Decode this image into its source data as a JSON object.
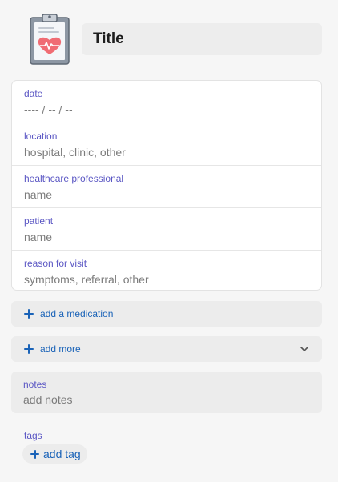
{
  "header": {
    "icon": "clipboard-heart-icon",
    "title": "Title"
  },
  "fields": [
    {
      "label": "date",
      "placeholder": "---- / -- / --"
    },
    {
      "label": "location",
      "placeholder": "hospital, clinic, other"
    },
    {
      "label": "healthcare professional",
      "placeholder": "name"
    },
    {
      "label": "patient",
      "placeholder": "name"
    },
    {
      "label": "reason for visit",
      "placeholder": "symptoms, referral, other"
    }
  ],
  "actions": {
    "add_medication": {
      "label": "add a medication",
      "icon": "plus-icon"
    },
    "add_more": {
      "label": "add more",
      "icon": "plus-icon",
      "expand_icon": "chevron-down-icon"
    }
  },
  "notes": {
    "label": "notes",
    "placeholder": "add notes"
  },
  "tags": {
    "label": "tags",
    "add_label": "add tag",
    "icon": "plus-icon"
  },
  "colors": {
    "accent_label": "#5b57c4",
    "action_blue": "#1a63b8",
    "placeholder": "#7c7c7c",
    "heart": "#f06c74"
  }
}
